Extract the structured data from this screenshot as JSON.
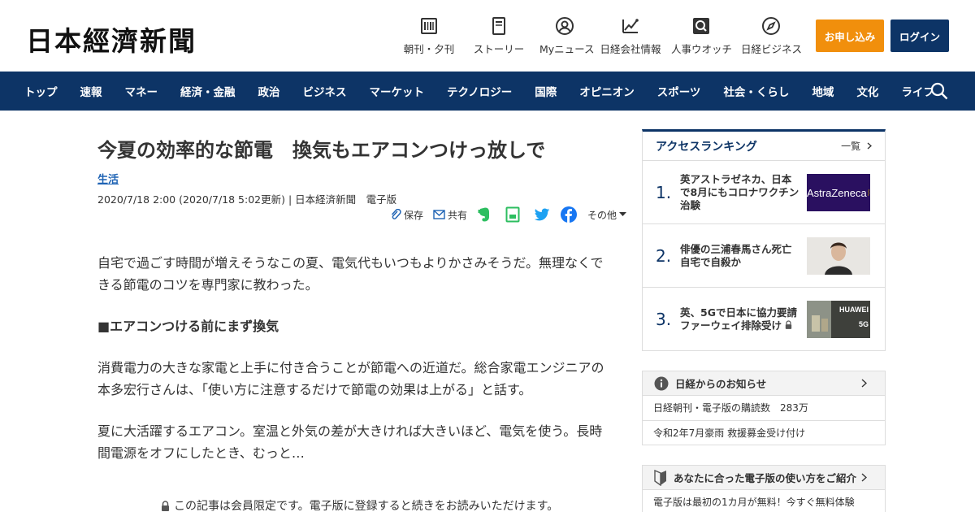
{
  "header": {
    "logo": "日本經濟新聞",
    "nav": [
      {
        "label": "朝刊・夕刊",
        "icon": "newspaper-icon"
      },
      {
        "label": "ストーリー",
        "icon": "story-icon"
      },
      {
        "label": "Myニュース",
        "icon": "user-icon"
      },
      {
        "label": "日経会社情報",
        "icon": "chart-icon"
      },
      {
        "label": "人事ウオッチ",
        "icon": "magnifier-icon"
      },
      {
        "label": "日経ビジネス",
        "icon": "compass-icon"
      }
    ],
    "subscribe_label": "お申し込み",
    "login_label": "ログイン"
  },
  "navbar": {
    "items": [
      "トップ",
      "速報",
      "マネー",
      "経済・金融",
      "政治",
      "ビジネス",
      "マーケット",
      "テクノロジー",
      "国際",
      "オピニオン",
      "スポーツ",
      "社会・くらし",
      "地域",
      "文化",
      "ライフ"
    ]
  },
  "article": {
    "headline": "今夏の効率的な節電　換気もエアコンつけっ放しで",
    "category": "生活",
    "meta": "2020/7/18 2:00 (2020/7/18 5:02更新) | 日本経済新聞　電子版",
    "share": {
      "save": "保存",
      "share": "共有",
      "other": "その他"
    },
    "paragraphs": [
      "自宅で過ごす時間が増えそうなこの夏、電気代もいつもよりかさみそうだ。無理なくできる節電のコツを専門家に教わった。",
      "■エアコンつける前にまず換気",
      "消費電力の大きな家電と上手に付き合うことが節電への近道だ。総合家電エンジニアの本多宏行さんは、「使い方に注意するだけで節電の効果は上がる」と話す。",
      "夏に大活躍するエアコン。室温と外気の差が大きければ大きいほど、電気を使う。長時間電源をオフにしたとき、むっと…"
    ],
    "paywall": "この記事は会員限定です。電子版に登録すると続きをお読みいただけます。"
  },
  "ranking": {
    "title": "アクセスランキング",
    "more": "一覧",
    "items": [
      {
        "rank": "1.",
        "text": "英アストラゼネカ、日本で8月にもコロナワクチン治験",
        "thumb": "AstraZeneca"
      },
      {
        "rank": "2.",
        "text": "俳優の三浦春馬さん死亡　自宅で自殺か",
        "thumb": ""
      },
      {
        "rank": "3.",
        "text": "英、5Gで日本に協力要請　ファーウェイ排除受け",
        "thumb": "HUAWEI 5G"
      }
    ]
  },
  "notices": {
    "title": "日経からのお知らせ",
    "rows": [
      "日経朝刊・電子版の購読数　283万",
      "令和2年7月豪雨 救援募金受け付け"
    ]
  },
  "guide": {
    "title": "あなたに合った電子版の使い方をご紹介",
    "rows": [
      "電子版は最初の1カ月が無料！今すぐ無料体験"
    ]
  },
  "colors": {
    "navy": "#0d3466",
    "orange": "#f18f0c",
    "link": "#1e63b4"
  }
}
